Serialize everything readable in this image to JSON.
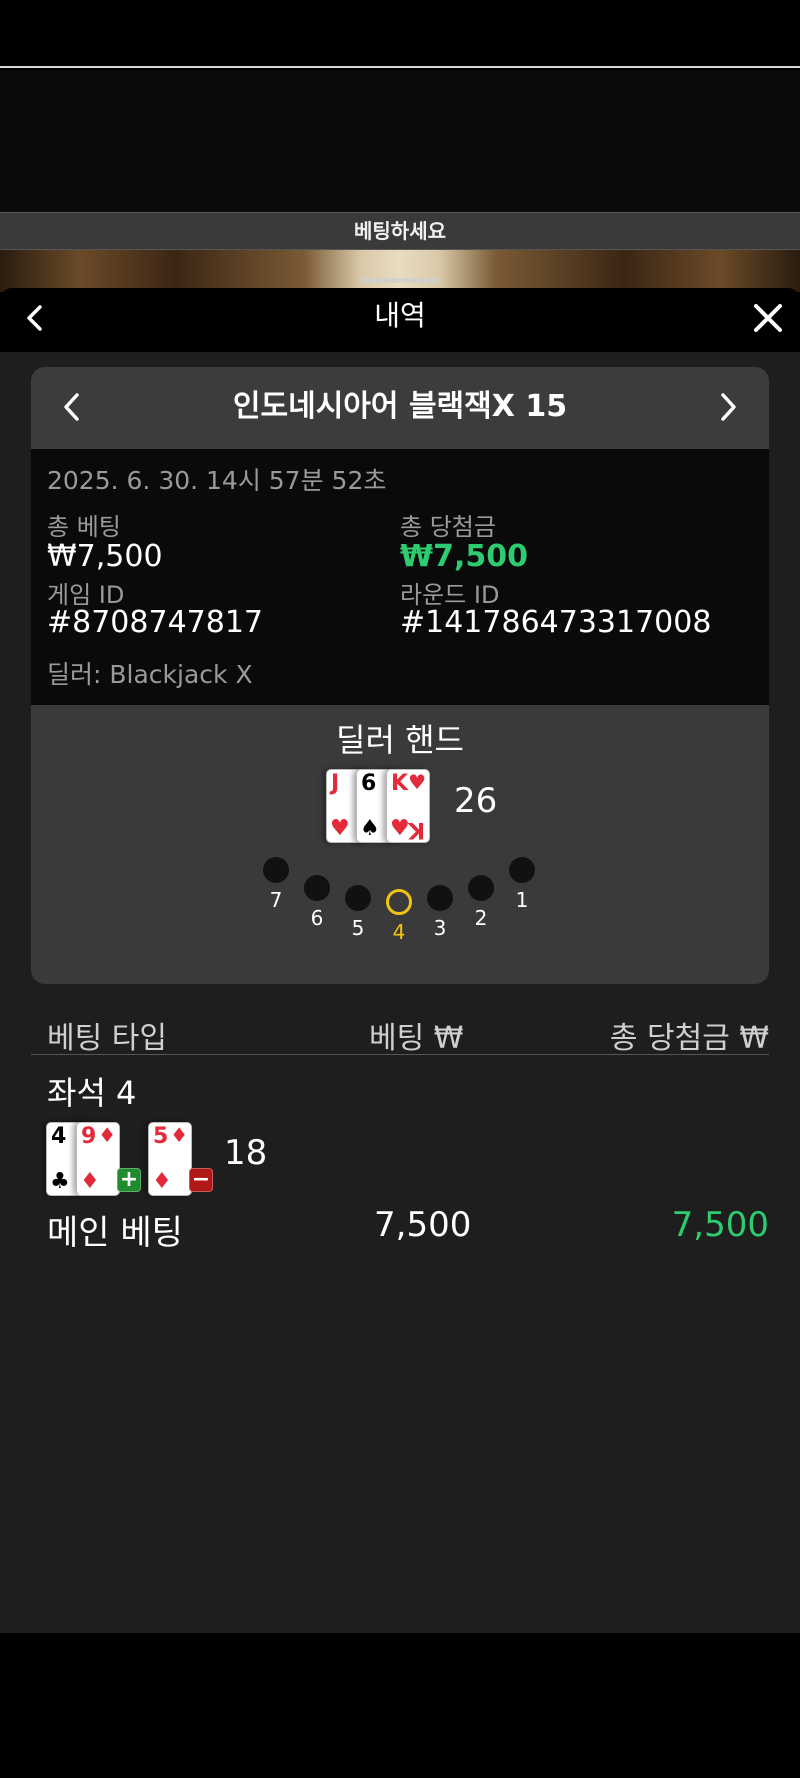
{
  "banner": {
    "place_bets": "베팅하세요"
  },
  "sheet": {
    "title": "내역"
  },
  "game": {
    "title": "인도네시아어 블랙잭X 15",
    "datetime": "2025. 6. 30. 14시 57분 52초",
    "total_bet_label": "총 베팅",
    "total_bet_value": "₩7,500",
    "total_win_label": "총 당첨금",
    "total_win_value": "₩7,500",
    "game_id_label": "게임 ID",
    "game_id_value": "#8708747817",
    "round_id_label": "라운드 ID",
    "round_id_value": "#141786473317008",
    "dealer_text": "딜러: Blackjack X"
  },
  "dealer_hand": {
    "title": "딜러 핸드",
    "cards": [
      {
        "rank": "J",
        "suit": "♥",
        "color": "#e22a3a"
      },
      {
        "rank": "6",
        "suit": "♠",
        "color": "#000000"
      },
      {
        "rank": "K",
        "suit": "♥",
        "color": "#e22a3a"
      }
    ],
    "total": "26"
  },
  "seats": [
    {
      "num": "7",
      "active": false
    },
    {
      "num": "6",
      "active": false
    },
    {
      "num": "5",
      "active": false
    },
    {
      "num": "4",
      "active": true
    },
    {
      "num": "3",
      "active": false
    },
    {
      "num": "2",
      "active": false
    },
    {
      "num": "1",
      "active": false
    }
  ],
  "bets_table": {
    "col_type": "베팅 타입",
    "col_bet": "베팅 ₩",
    "col_win": "총 당첨금 ₩",
    "seat_label": "좌석 4",
    "player_cards": [
      {
        "rank": "4",
        "suit": "♣",
        "color": "#000000"
      },
      {
        "rank": "9",
        "suit": "♦",
        "color": "#e22a3a"
      },
      {
        "rank": "5",
        "suit": "♦",
        "color": "#e22a3a"
      }
    ],
    "player_total": "18",
    "rows": [
      {
        "type": "메인 베팅",
        "bet": "7,500",
        "win": "7,500"
      }
    ]
  },
  "colors": {
    "win_green": "#2ecc71",
    "active_seat": "#f2c40f"
  }
}
